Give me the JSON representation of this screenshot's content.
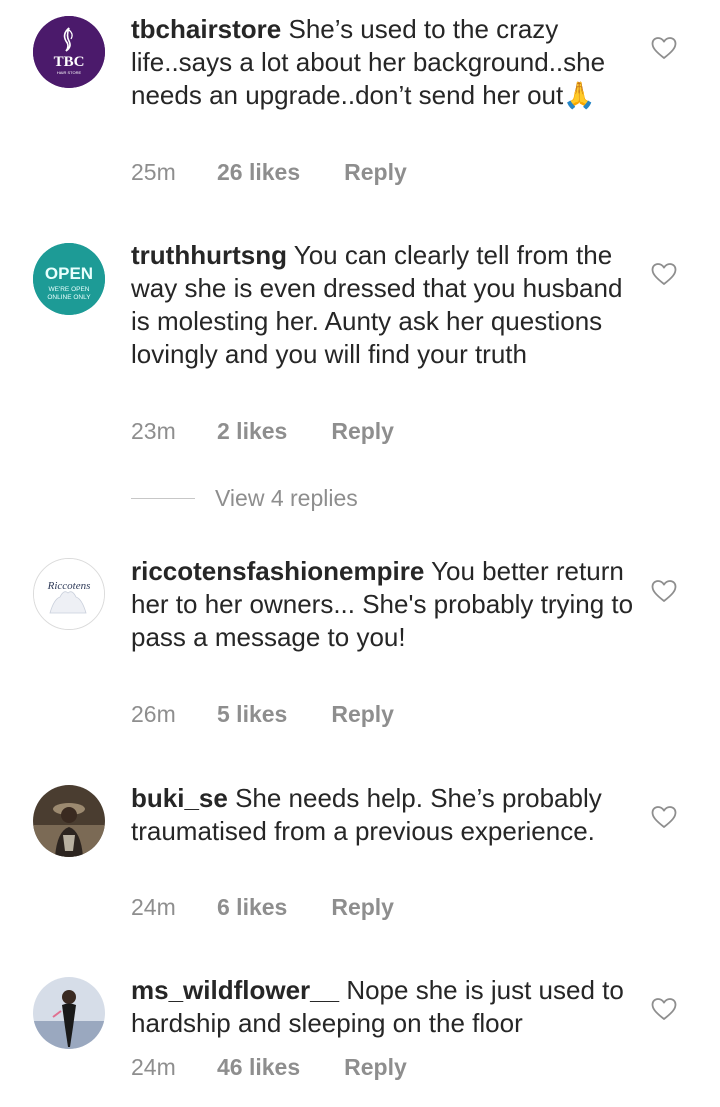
{
  "comments": [
    {
      "username": "tbchairstore",
      "text": "She’s used to the crazy life..says a lot about her background..she needs an upgrade..don’t send her out🙏",
      "time": "25m",
      "likes": "26 likes",
      "reply": "Reply",
      "avatar": {
        "icon": "tbc-logo-icon",
        "bg": "#4b1a6b",
        "line1": "TBC",
        "line2": "HAIR STORE"
      }
    },
    {
      "username": "truthhurtsng",
      "text": "You can clearly tell from the way she is even dressed that you husband is molesting her. Aunty ask her questions lovingly and you will find your truth",
      "time": "23m",
      "likes": "2 likes",
      "reply": "Reply",
      "avatar": {
        "icon": "open-sign-icon",
        "bg": "#1d9b96",
        "line1": "OPEN",
        "line2": "WE'RE OPEN",
        "line3": "ONLINE ONLY"
      }
    },
    {
      "username": "riccotensfashionempire",
      "text": "You better return her to her owners... She's probably trying to pass a message to you!",
      "time": "26m",
      "likes": "5 likes",
      "reply": "Reply",
      "avatar": {
        "icon": "riccotens-logo-icon",
        "bg": "#ffffff",
        "line1": "Riccotens"
      }
    },
    {
      "username": "buki_se",
      "text": "She needs help. She’s probably traumatised from a previous experience.",
      "time": "24m",
      "likes": "6 likes",
      "reply": "Reply",
      "avatar": {
        "icon": "user-photo-icon",
        "bg": "#5a4a3a"
      }
    },
    {
      "username": "ms_wildflower__",
      "text": "Nope she is just used to hardship and sleeping on the floor",
      "time": "24m",
      "likes": "46 likes",
      "reply": "Reply",
      "avatar": {
        "icon": "user-photo-icon",
        "bg": "#cdd6e3"
      }
    }
  ],
  "view_replies": "View 4 replies",
  "colors": {
    "text": "#262626",
    "meta": "#8e8e8e",
    "divider": "#c7c7c7"
  }
}
